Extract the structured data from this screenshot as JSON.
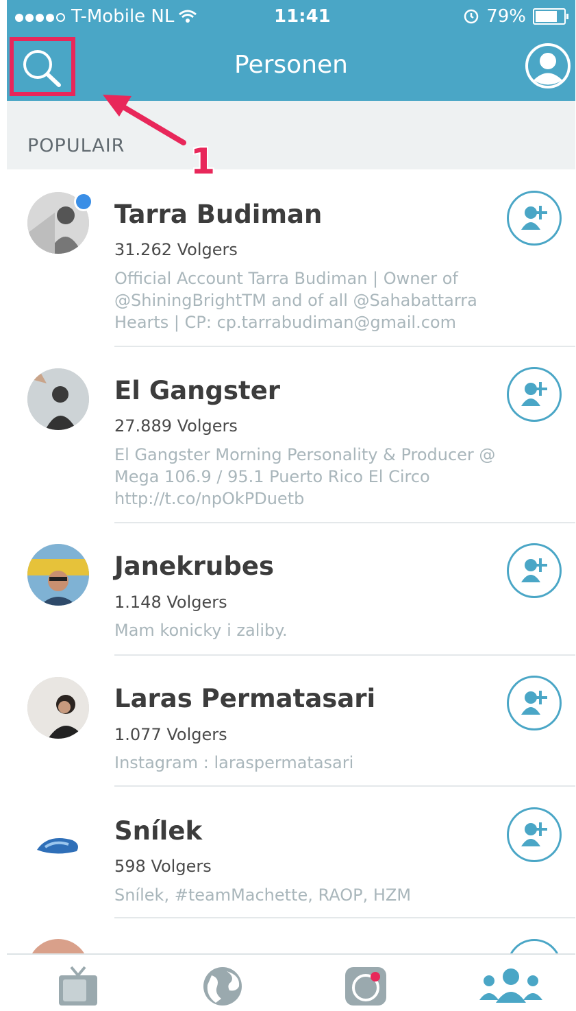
{
  "status_bar": {
    "carrier": "T-Mobile NL",
    "time": "11:41",
    "battery": "79%",
    "battery_level": 0.79
  },
  "nav": {
    "title": "Personen",
    "search_icon": "search-icon",
    "profile_icon": "profile-icon"
  },
  "annotation": {
    "number": "1",
    "color": "#e8275a"
  },
  "section": {
    "label": "POPULAIR"
  },
  "people": [
    {
      "name": "Tarra Budiman",
      "followers": "31.262 Volgers",
      "bio": "Official Account Tarra Budiman | Owner of @ShiningBrightTM and of all @Sahabattarra Hearts | CP: cp.tarrabudiman@gmail.com",
      "verified": true
    },
    {
      "name": "El Gangster",
      "followers": "27.889 Volgers",
      "bio": "El Gangster Morning Personality & Producer @ Mega 106.9 / 95.1 Puerto Rico El Circo http://t.co/npOkPDuetb",
      "verified": false
    },
    {
      "name": "Janekrubes",
      "followers": "1.148 Volgers",
      "bio": "Mam konicky i zaliby.",
      "verified": false
    },
    {
      "name": "Laras Permatasari",
      "followers": "1.077 Volgers",
      "bio": "Instagram : laraspermatasari",
      "verified": false
    },
    {
      "name": "Snílek",
      "followers": "598 Volgers",
      "bio": "Snílek, #teamMachette, RAOP, HZM",
      "verified": false
    }
  ],
  "tab_bar": {
    "tabs": [
      "tv-icon",
      "globe-icon",
      "camera-icon",
      "people-icon"
    ],
    "active_color": "#4aa6c6",
    "inactive_color": "#9aa9ae"
  },
  "colors": {
    "accent": "#4aa6c6",
    "header_bg": "#eef1f2"
  }
}
